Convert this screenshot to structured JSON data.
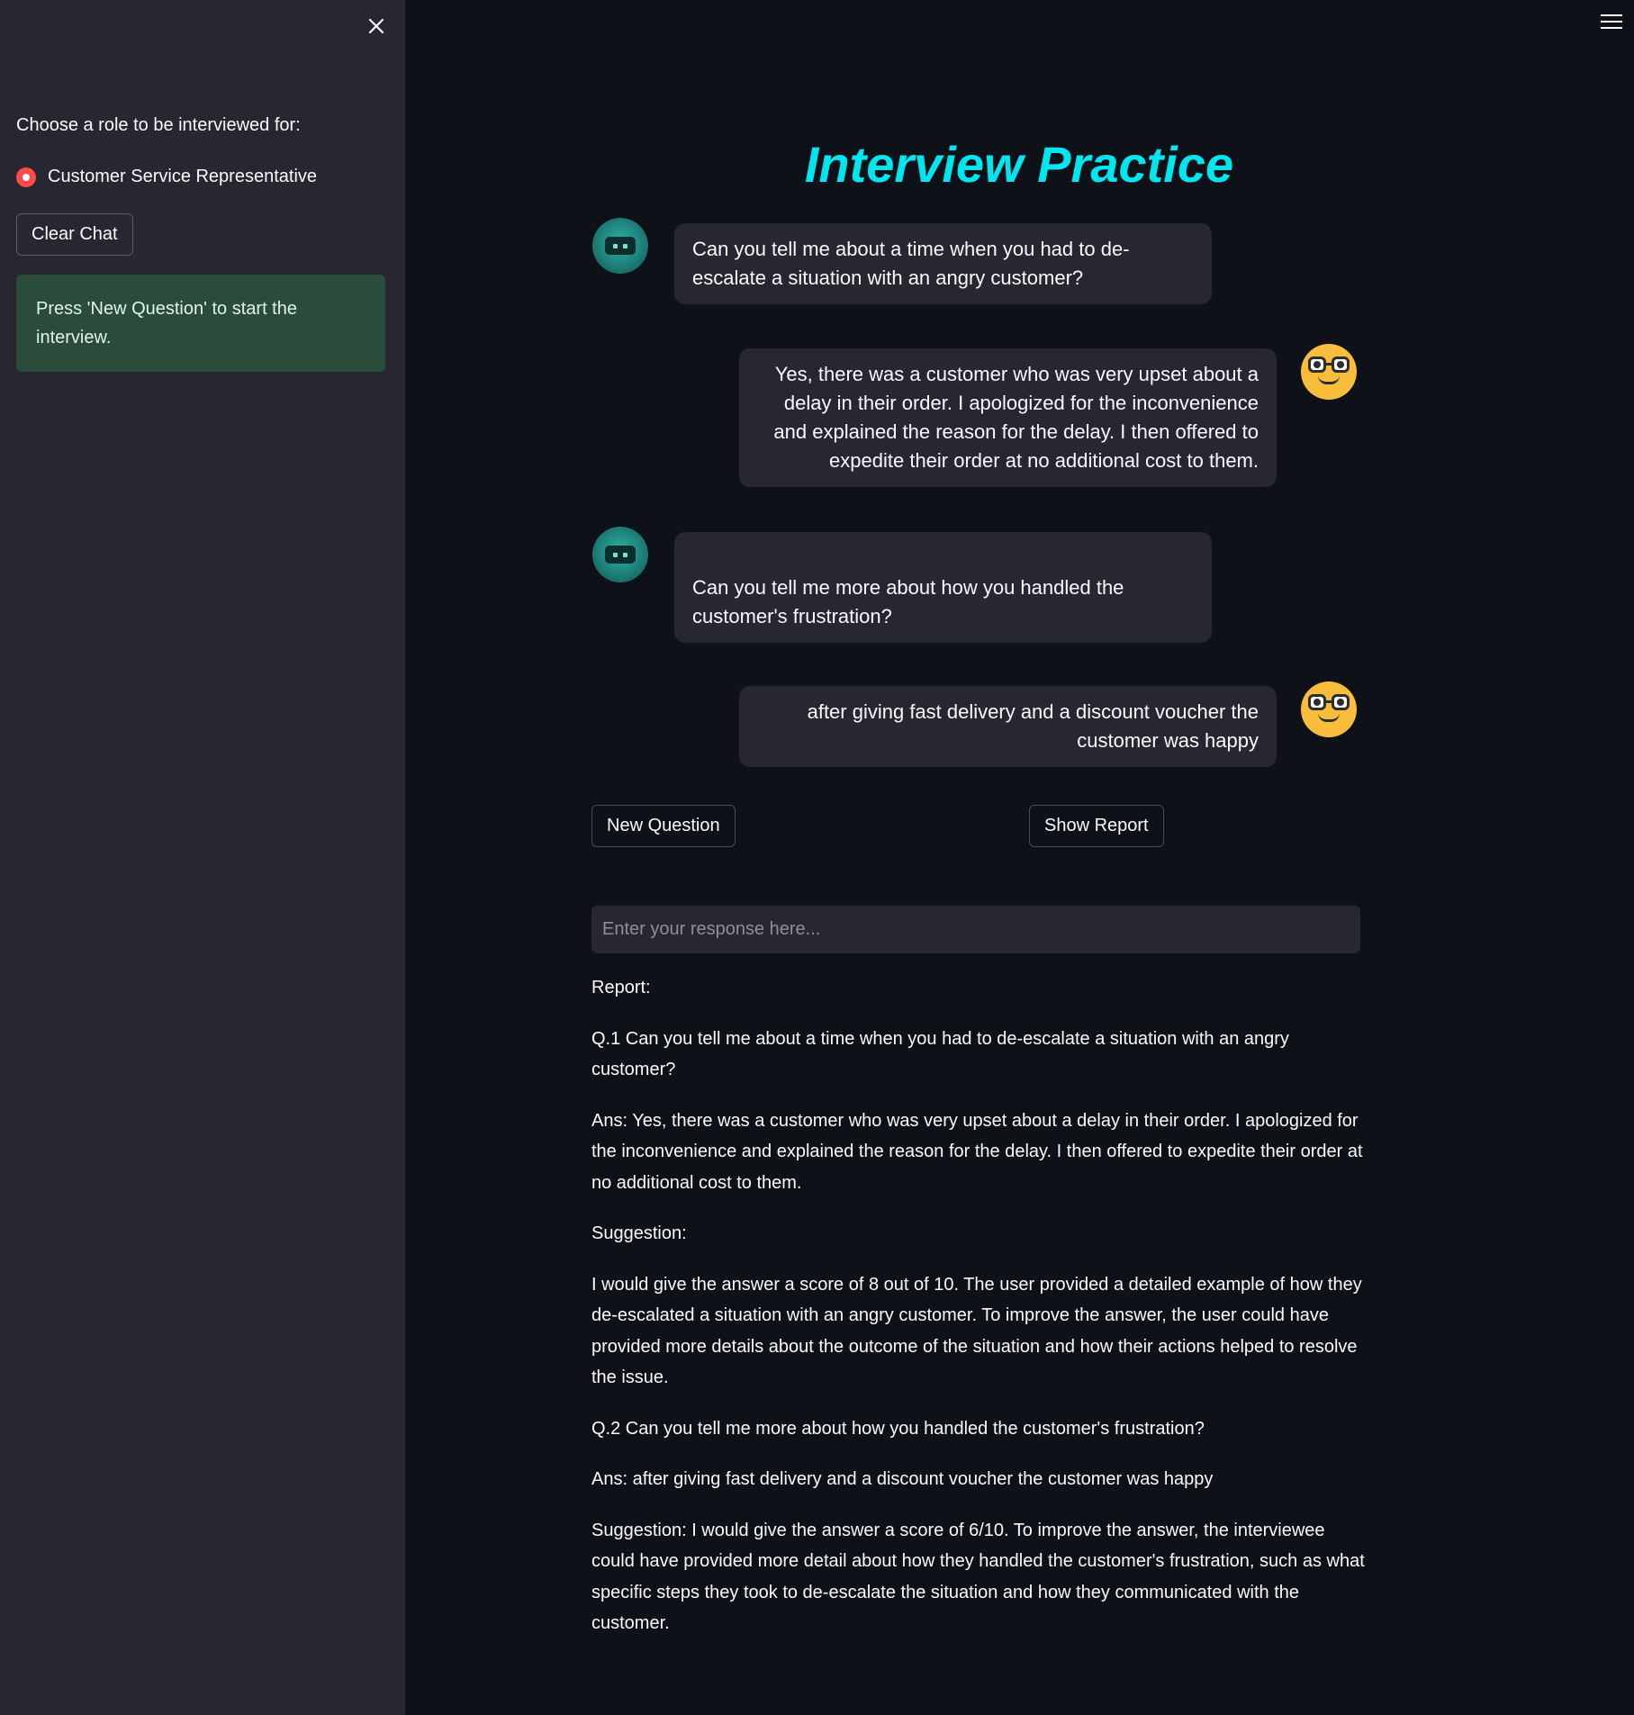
{
  "sidebar": {
    "role_label": "Choose a role to be interviewed for:",
    "role_option": "Customer Service Representative",
    "clear_button": "Clear Chat",
    "info_message": "Press 'New Question' to start the interview."
  },
  "main": {
    "title": "Interview Practice",
    "messages": [
      {
        "role": "bot",
        "text": "Can you tell me about a time when you had to de-escalate a situation with an angry customer?"
      },
      {
        "role": "user",
        "text": "Yes, there was a customer who was very upset about a delay in their order. I apologized for the inconvenience and explained the reason for the delay. I then offered to expedite their order at no additional cost to them."
      },
      {
        "role": "bot",
        "text": "Can you tell me more about how you handled the customer's frustration?"
      },
      {
        "role": "user",
        "text": "after giving fast delivery and a discount voucher the customer was happy"
      }
    ],
    "new_question_button": "New Question",
    "show_report_button": "Show Report",
    "response_placeholder": "Enter your response here..."
  },
  "report": {
    "heading": "Report:",
    "q1": "Q.1 Can you tell me about a time when you had to de-escalate a situation with an angry customer?",
    "a1": "Ans: Yes, there was a customer who was very upset about a delay in their order. I apologized for the inconvenience and explained the reason for the delay. I then offered to expedite their order at no additional cost to them.",
    "s1_heading": "Suggestion:",
    "s1": "I would give the answer a score of 8 out of 10. The user provided a detailed example of how they de-escalated a situation with an angry customer. To improve the answer, the user could have provided more details about the outcome of the situation and how their actions helped to resolve the issue.",
    "q2": "Q.2 Can you tell me more about how you handled the customer's frustration?",
    "a2": "Ans: after giving fast delivery and a discount voucher the customer was happy",
    "s2": "Suggestion: I would give the answer a score of 6/10. To improve the answer, the interviewee could have provided more detail about how they handled the customer's frustration, such as what specific steps they took to de-escalate the situation and how they communicated with the customer."
  },
  "icons": {
    "close": "close-icon",
    "menu": "hamburger-menu-icon",
    "bot_avatar": "robot-avatar-icon",
    "user_avatar": "nerd-face-avatar-icon"
  },
  "colors": {
    "accent": "#ff4b4b",
    "title": "#00e5ee",
    "background": "#0e1117",
    "sidebar": "#262730",
    "info_box": "#2b4b3b"
  }
}
